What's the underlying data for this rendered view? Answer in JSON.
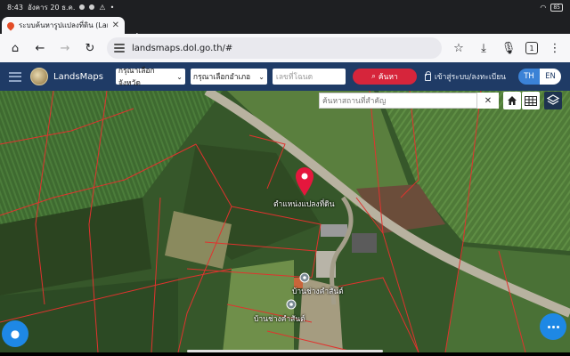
{
  "status_bar": {
    "time": "8:43",
    "date": "อังคาร 20 ธ.ค.",
    "battery": "85"
  },
  "browser": {
    "tab_title": "ระบบค้นหารูปแปลงที่ดิน (Lan",
    "url": "landsmaps.dol.go.th/#",
    "tab_count": "1"
  },
  "site": {
    "brand": "LandsMaps",
    "province_select": "กรุณาเลือกจังหวัด",
    "district_select": "กรุณาเลือกอำเภอ",
    "deed_placeholder": "เลขที่โฉนด",
    "search_label": "ค้นหา",
    "login_label": "เข้าสู่ระบบ/ลงทะเบียน",
    "lang_th": "TH",
    "lang_en": "EN"
  },
  "map": {
    "place_search_placeholder": "ค้นหาสถานที่สำคัญ",
    "parcel_label": "ตำแหน่งแปลงที่ดิน",
    "poi_1": "บ้านช่างคำสันต์",
    "poi_2": "บ้านช่างคำสันต์",
    "boundary_color": "#e0332e",
    "pin_color": "#e5173d"
  },
  "colors": {
    "header_bg": "#1f3b66",
    "search_btn": "#d6253b",
    "lang_active": "#3b82d6",
    "fab": "#1e88e5"
  }
}
